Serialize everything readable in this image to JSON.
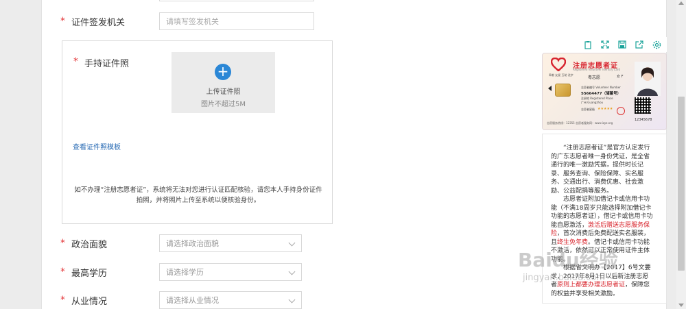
{
  "form": {
    "issuer": {
      "required": "*",
      "label": "证件签发机关",
      "placeholder": "请填写签发机关"
    },
    "handheld": {
      "required": "*",
      "label": "手持证件照",
      "upload_icon": "plus-circle-icon",
      "upload_title": "上传证件照",
      "upload_hint": "图片不超过5M",
      "template_link": "查看证件照模板",
      "note": "如不办理“注册志愿者证”，系统将无法对您进行认证匹配核验，请您本人手持身份证件拍照，并将照片上传至系统以便核验身份。"
    },
    "political": {
      "required": "*",
      "label": "政治面貌",
      "placeholder": "请选择政治面貌"
    },
    "education": {
      "required": "*",
      "label": "最高学历",
      "placeholder": "请选择学历"
    },
    "employment": {
      "required": "*",
      "label": "从业情况",
      "placeholder": "请选择从业情况"
    }
  },
  "toolbar": {
    "icons": [
      "clipboard-icon",
      "expand-icon",
      "save-icon",
      "share-icon",
      "settings-icon"
    ]
  },
  "card": {
    "title": "注册志愿者证",
    "subtitle": "Registered Volunteer Identity Card",
    "tags": "奉献 友爱 互助 进步",
    "name": "粤志愿",
    "gender": "女 F",
    "line1": "志愿者编号 Volunteer Number",
    "number": "55664477（储蓄号）",
    "line2": "注册地 Registered Place",
    "place": "广州 Guangzhou",
    "line3": "志愿者星级",
    "stars": "★★★★★",
    "id": "12345678",
    "footer": "志愿服务热线：12355    志愿者服务网：www.izyz.org"
  },
  "description": {
    "p1": "“注册志愿者证”是官方认定发行的广东志愿者唯一身份凭证，是全省通行的唯一激励凭据，提供时长记录、服务查询、保险保障、实名服务、交通出行、消费优惠、社会激励、公益配捐等服务。",
    "p2_a": "志愿者证附加借记卡或信用卡功能（不满18周岁只能选择附加借记卡功能的志愿者证），借记卡或信用卡功能自愿激活，",
    "p2_red": "激活后赠送志愿服务保险",
    "p2_b": "，首次消费后免费配送实名服装，且",
    "p2_red2": "终生免年费",
    "p2_c": "。借记卡或信用卡功能不激活，依然可以正常使用证件主体功能。",
    "p3_a": "根据省文明办【2017】6号文要求，2017年8月1日以后新注册志愿者",
    "p3_red": "原则上都要办理志愿者证",
    "p3_b": "，保障您的权益并享受相关激励。"
  },
  "watermark": {
    "main": "Baidu经验",
    "sub": "jingyan.baidu.com"
  }
}
